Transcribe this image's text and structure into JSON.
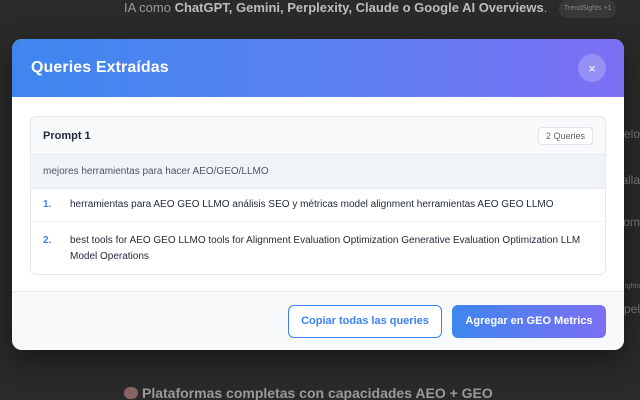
{
  "background": {
    "top_prefix": "IA como ",
    "top_bold": "ChatGPT, Gemini, Perplexity, Claude o Google AI Overviews",
    "top_suffix": ".",
    "top_badge": "TrendSights +1",
    "right_snippets": [
      "elo",
      "alla",
      "om",
      "ights",
      "pel"
    ],
    "bottom_heading": "Plataformas completas con capacidades AEO + GEO"
  },
  "modal": {
    "title": "Queries Extraídas",
    "close_symbol": "×",
    "prompt": {
      "name": "Prompt 1",
      "count": "2 Queries",
      "text": "mejores herramientas para hacer AEO/GEO/LLMO"
    },
    "queries": [
      {
        "num": "1.",
        "text": "herramientas para AEO GEO LLMO análisis SEO y métricas model alignment herramientas AEO GEO LLMO"
      },
      {
        "num": "2.",
        "text": "best tools for AEO GEO LLMO tools for Alignment Evaluation Optimization Generative Evaluation Optimization LLM Model Operations"
      }
    ],
    "copy_label": "Copiar todas las queries",
    "add_label": "Agregar en GEO Metrics"
  },
  "colors": {
    "accent": "#3b82f6",
    "gradient_start": "#3e86ee",
    "gradient_end": "#7c6ff3"
  }
}
